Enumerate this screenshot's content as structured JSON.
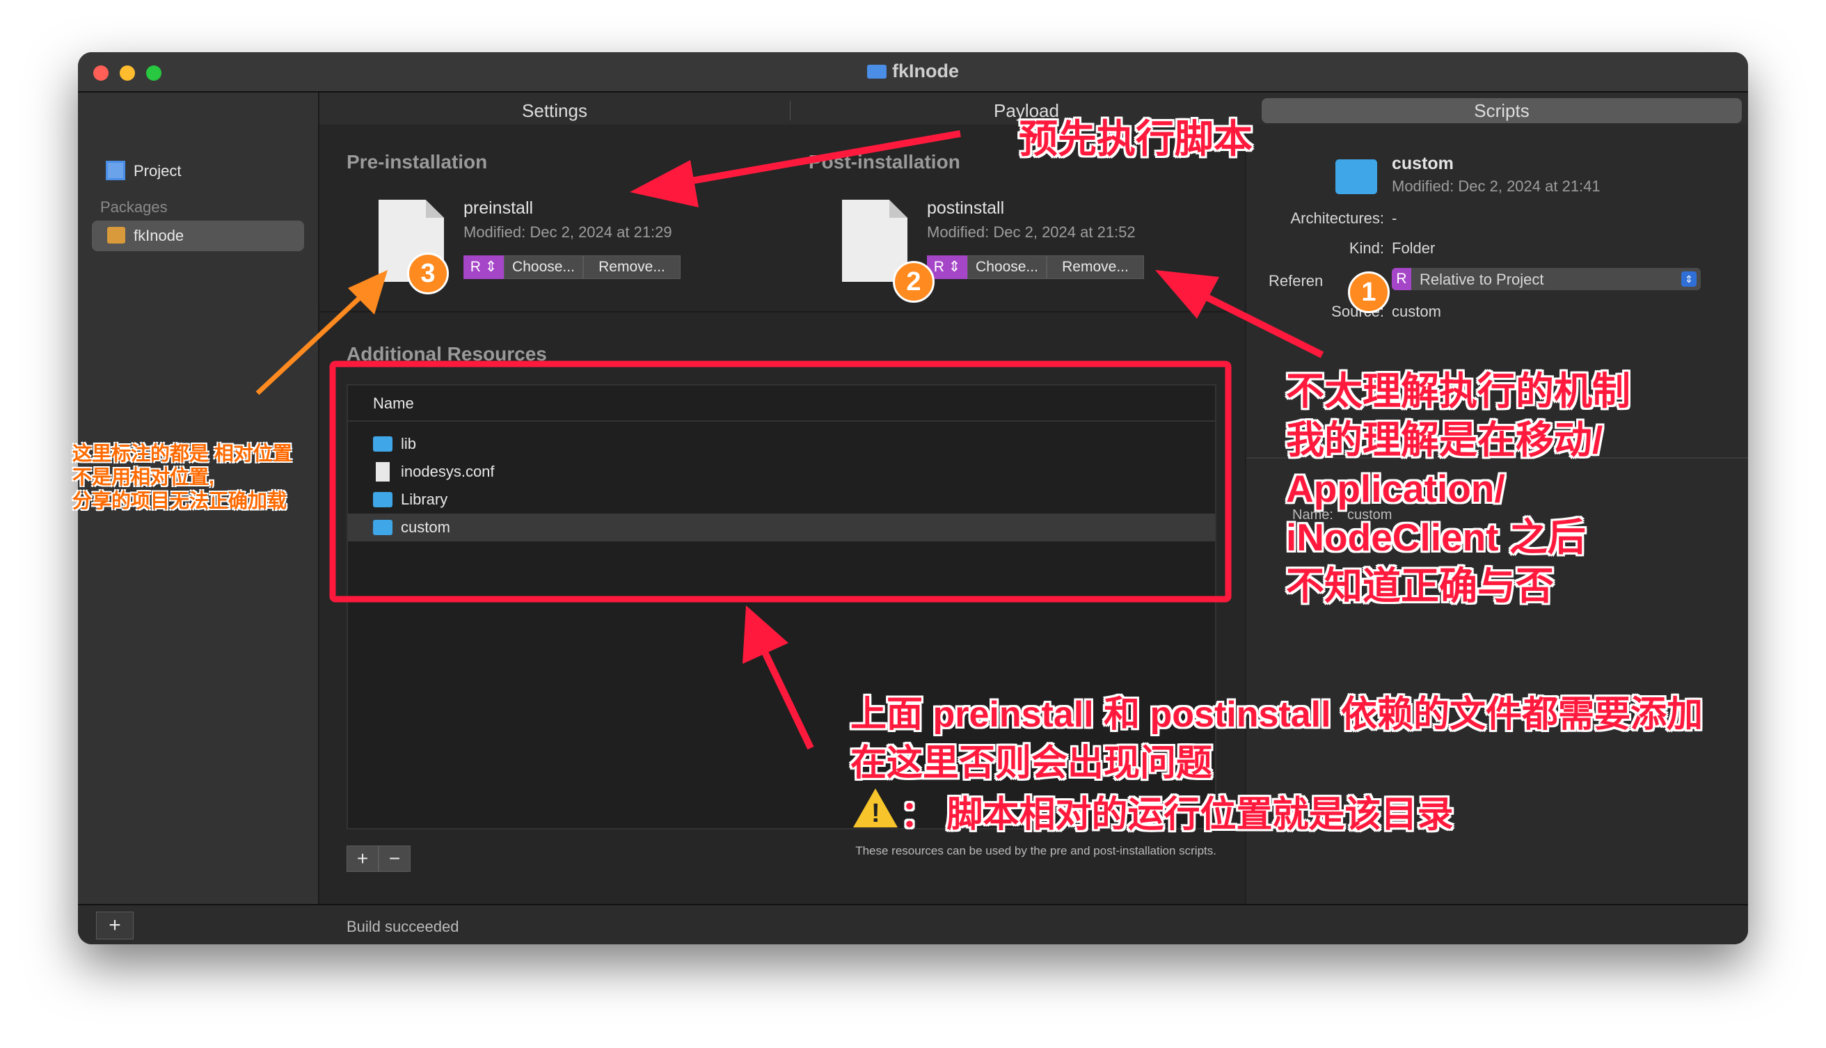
{
  "window": {
    "title": "fkInode"
  },
  "sidebar": {
    "project_label": "Project",
    "packages_heading": "Packages",
    "package_item": "fkInode",
    "add_label": "+"
  },
  "tabs": [
    "Settings",
    "Payload",
    "Scripts"
  ],
  "pre_installation": {
    "heading": "Pre-installation",
    "file_name": "preinstall",
    "modified": "Modified:  Dec 2, 2024 at 21:29",
    "ref_label": "R ⇕",
    "choose": "Choose...",
    "remove": "Remove..."
  },
  "post_installation": {
    "heading": "Post-installation",
    "file_name": "postinstall",
    "modified": "Modified:  Dec 2, 2024 at 21:52",
    "ref_label": "R ⇕",
    "choose": "Choose...",
    "remove": "Remove..."
  },
  "resources": {
    "heading": "Additional Resources",
    "column_name": "Name",
    "items": [
      "lib",
      "inodesys.conf",
      "Library",
      "custom"
    ],
    "add_btn": "+",
    "remove_btn": "−",
    "footnote": "These resources can be used by the pre and post-installation scripts."
  },
  "info_panel": {
    "name": "custom",
    "modified": "Modified:  Dec 2, 2024 at 21:41",
    "architectures_label": "Architectures:",
    "architectures_value": "-",
    "kind_label": "Kind:",
    "kind_value": "Folder",
    "reference_label": "Referen",
    "reference_badge": "R",
    "reference_value": "Relative to Project",
    "source_label": "Source:",
    "source_value": "custom",
    "name_label": "Name:",
    "name_value": "custom"
  },
  "status": {
    "text": "Build succeeded"
  },
  "annotations": {
    "pre_script": "预先执行脚本",
    "mechanism": [
      "不太理解执行的机制",
      "我的理解是在移动/",
      "Application/",
      "iNodeClient 之后",
      "不知道正确与否"
    ],
    "dependencies": [
      "上面 preinstall 和 postinstall 依赖的文件都需要添加",
      "在这里否则会出现问题"
    ],
    "warning": "：  脚本相对的运行位置就是该目录",
    "relative": [
      "这里标注的都是 相对位置",
      "不是用相对位置,",
      "分享的项目无法正确加载"
    ],
    "badge_1": "1",
    "badge_2": "2",
    "badge_3": "3"
  },
  "colors": {
    "annotation_red": "#ff1a3d",
    "annotation_orange": "#ff6a00",
    "folder_blue": "#3fa6e8",
    "ref_purple": "#a545c7"
  }
}
